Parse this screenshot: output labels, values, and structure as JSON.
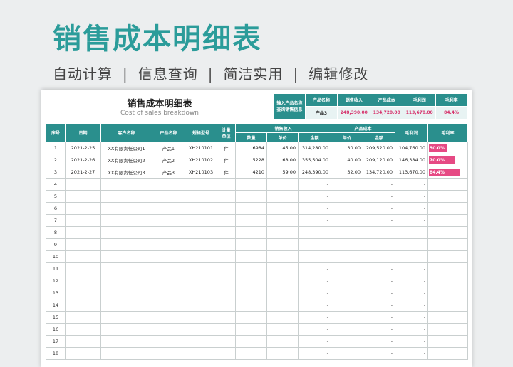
{
  "hero": {
    "title": "销售成本明细表",
    "features": [
      "自动计算",
      "信息查询",
      "简洁实用",
      "编辑修改"
    ],
    "separator": "|"
  },
  "sheet": {
    "title": "销售成本明细表",
    "subtitle": "Cost of sales breakdown",
    "query": {
      "label_line1": "输入产品名称",
      "label_line2": "查询销售信息",
      "headers": [
        "产品名称",
        "销售收入",
        "产品成本",
        "毛利润",
        "毛利率"
      ],
      "values": [
        "产品3",
        "248,390.00",
        "134,720.00",
        "113,670.00",
        "84.4%"
      ]
    },
    "columns": {
      "seq": "序号",
      "date": "日期",
      "customer": "客户名称",
      "product": "产品名称",
      "model": "规格型号",
      "unit_line1": "计量",
      "unit_line2": "单位",
      "sales_group": "销售收入",
      "cost_group": "产品成本",
      "qty": "数量",
      "price": "单价",
      "amount": "金额",
      "cost_price": "单价",
      "cost_amount": "金额",
      "profit": "毛利润",
      "margin": "毛利率"
    },
    "rows": [
      {
        "seq": "1",
        "date": "2021-2-25",
        "customer": "XX有限责任公司1",
        "product": "产品1",
        "model": "XH210101",
        "unit": "件",
        "qty": "6984",
        "price": "45.00",
        "amount": "314,280.00",
        "cost_price": "30.00",
        "cost_amount": "209,520.00",
        "profit": "104,760.00",
        "margin": "50.0%",
        "margin_value": 0.5
      },
      {
        "seq": "2",
        "date": "2021-2-26",
        "customer": "XX有限责任公司2",
        "product": "产品2",
        "model": "XH210102",
        "unit": "件",
        "qty": "5228",
        "price": "68.00",
        "amount": "355,504.00",
        "cost_price": "40.00",
        "cost_amount": "209,120.00",
        "profit": "146,384.00",
        "margin": "70.0%",
        "margin_value": 0.7
      },
      {
        "seq": "3",
        "date": "2021-2-27",
        "customer": "XX有限责任公司3",
        "product": "产品3",
        "model": "XH210103",
        "unit": "件",
        "qty": "4210",
        "price": "59.00",
        "amount": "248,390.00",
        "cost_price": "32.00",
        "cost_amount": "134,720.00",
        "profit": "113,670.00",
        "margin": "84.4%",
        "margin_value": 0.844
      }
    ],
    "empty_rows": [
      "4",
      "5",
      "6",
      "7",
      "8",
      "9",
      "10",
      "11",
      "12",
      "13",
      "14",
      "15",
      "16",
      "17",
      "18"
    ],
    "dash": "-"
  }
}
